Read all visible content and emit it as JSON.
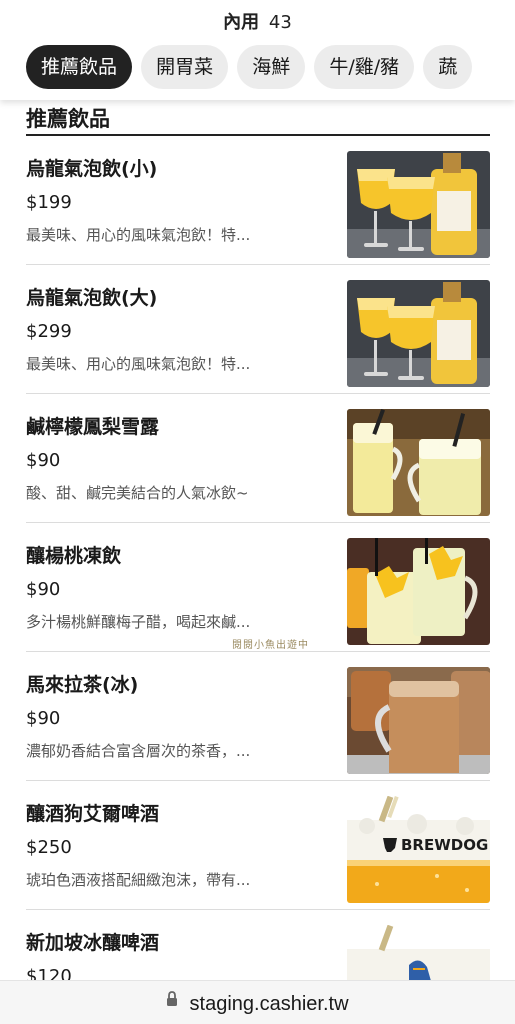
{
  "header": {
    "table_label": "內用",
    "table_number": "43"
  },
  "tabs": [
    {
      "label": "推薦飲品",
      "active": true
    },
    {
      "label": "開胃菜",
      "active": false
    },
    {
      "label": "海鮮",
      "active": false
    },
    {
      "label": "牛/雞/豬",
      "active": false
    },
    {
      "label": "蔬",
      "active": false
    }
  ],
  "section": {
    "title": "推薦飲品"
  },
  "items": [
    {
      "name": "烏龍氣泡飲(小)",
      "price": "$199",
      "desc": "最美味、用心的風味氣泡飲！特...",
      "photo": "oolong-sparkling-drink-photo"
    },
    {
      "name": "烏龍氣泡飲(大)",
      "price": "$299",
      "desc": "最美味、用心的風味氣泡飲！特...",
      "photo": "oolong-sparkling-drink-photo"
    },
    {
      "name": "鹹檸檬鳳梨雪露",
      "price": "$90",
      "desc": "酸、甜、鹹完美結合的人氣冰飲~",
      "photo": "lemon-pineapple-slush-photo"
    },
    {
      "name": "釀楊桃凍飲",
      "price": "$90",
      "desc": "多汁楊桃鮮釀梅子醋，喝起來鹹...",
      "photo": "starfruit-iced-drink-photo"
    },
    {
      "name": "馬來拉茶(冰)",
      "price": "$90",
      "desc": "濃郁奶香結合富含層次的茶香，...",
      "photo": "malay-milk-tea-photo"
    },
    {
      "name": "釀酒狗艾爾啤酒",
      "price": "$250",
      "desc": "琥珀色酒液搭配細緻泡沫，帶有...",
      "photo": "brewdog-ale-photo",
      "photo_text": "BREWDOG"
    },
    {
      "name": "新加坡冰釀啤酒",
      "price": "$120",
      "desc": "",
      "photo": "tiger-beer-photo"
    }
  ],
  "watermark": "閱閱小魚出遊中",
  "browser": {
    "url": "staging.cashier.tw"
  },
  "colors": {
    "active_tab": "#222222",
    "inactive_tab": "#ececec",
    "divider": "#dcdcdc"
  }
}
